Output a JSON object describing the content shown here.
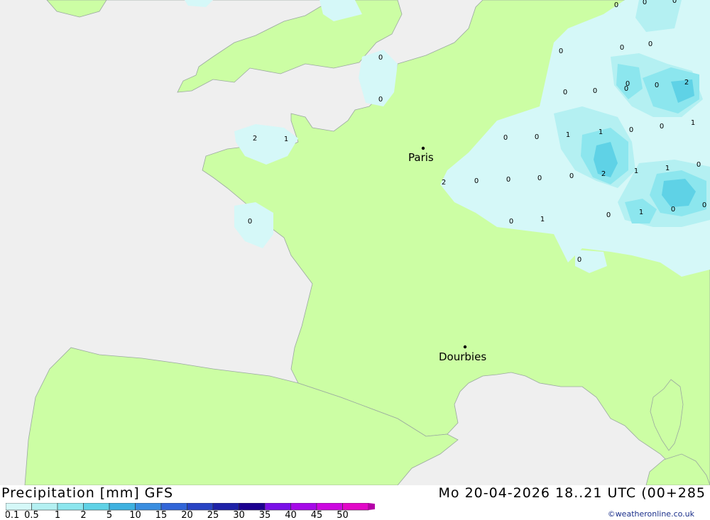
{
  "map": {
    "cities": [
      {
        "name": "Paris"
      },
      {
        "name": "Dourbies"
      }
    ],
    "values": [
      "0",
      "0",
      "0",
      "0",
      "0",
      "0",
      "0",
      "0",
      "0",
      "0",
      "0",
      "0",
      "2",
      "0",
      "0",
      "1",
      "1",
      "2",
      "0",
      "0",
      "1",
      "1",
      "0",
      "1",
      "0",
      "0",
      "0",
      "0",
      "2",
      "0",
      "1",
      "0",
      "0",
      "0",
      "1",
      "0",
      "2",
      "1",
      "0",
      "0",
      "0",
      "0",
      "0",
      "0",
      "0"
    ]
  },
  "footer": {
    "title": "Precipitation [mm] GFS",
    "datetime": "Mo 20-04-2026 18..21 UTC (00+285",
    "credit": "©weatheronline.co.uk"
  },
  "legend": {
    "ticks": [
      "0.1",
      "0.5",
      "1",
      "2",
      "5",
      "10",
      "15",
      "20",
      "25",
      "30",
      "35",
      "40",
      "45",
      "50"
    ],
    "colors": [
      "#d5f8f8",
      "#b4f0f2",
      "#8ce6ee",
      "#5fd2e6",
      "#3fb2e0",
      "#3a8ee0",
      "#3266d8",
      "#2844c4",
      "#1e22a8",
      "#1c0090",
      "#7a10e8",
      "#a60ae8",
      "#cc08e0",
      "#e208c8",
      "#b400a8"
    ],
    "land_color": "#ccfea4",
    "sea_color": "#efefef"
  }
}
